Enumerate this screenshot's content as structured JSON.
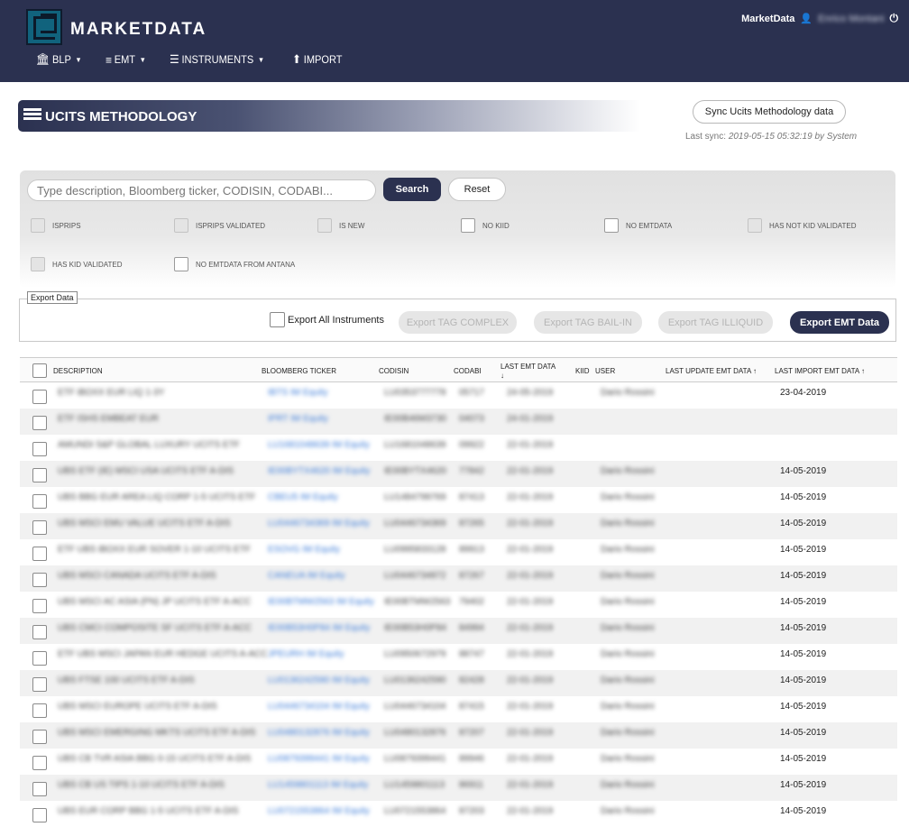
{
  "app": {
    "brand": "MARKETDATA",
    "user_app": "MarketData",
    "user_name": "Enrico Montani"
  },
  "nav": [
    {
      "label": "BLP",
      "icon": "bank-icon",
      "has_caret": true
    },
    {
      "label": "EMT",
      "icon": "database-icon",
      "has_caret": true
    },
    {
      "label": "INSTRUMENTS",
      "icon": "list-icon",
      "has_caret": true
    },
    {
      "label": "IMPORT",
      "icon": "upload-icon",
      "has_caret": false
    }
  ],
  "page": {
    "title": "UCITS METHODOLOGY",
    "sync_button": "Sync Ucits Methodology data",
    "last_sync_label": "Last sync: ",
    "last_sync_value": "2019-05-15 05:32:19 by System"
  },
  "search": {
    "placeholder": "Type description, Bloomberg ticker, CODISIN, CODABI...",
    "search_label": "Search",
    "reset_label": "Reset"
  },
  "filters": [
    {
      "label": "ISPRIPS",
      "style": "grey"
    },
    {
      "label": "ISPRIPS VALIDATED",
      "style": "grey"
    },
    {
      "label": "IS NEW",
      "style": "grey"
    },
    {
      "label": "NO KIID",
      "style": "white"
    },
    {
      "label": "NO EMTDATA",
      "style": "white"
    },
    {
      "label": "HAS NOT KID VALIDATED",
      "style": "grey"
    },
    {
      "label": "HAS KID VALIDATED",
      "style": "grey"
    },
    {
      "label": "NO EMTDATA FROM ANTANA",
      "style": "white"
    }
  ],
  "export": {
    "legend": "Export Data",
    "all_instruments": "Export All Instruments",
    "tag_complex": "Export TAG COMPLEX",
    "tag_bail_in": "Export TAG BAIL-IN",
    "tag_illiquid": "Export TAG ILLIQUID",
    "emt_data": "Export EMT Data"
  },
  "table": {
    "headers": {
      "description": "DESCRIPTION",
      "ticker": "BLOOMBERG TICKER",
      "codisin": "CODISIN",
      "codabi": "CODABI",
      "last_emt": "LAST EMT DATA",
      "last_emt_sort": "↓",
      "kiid": "KIID",
      "user": "USER",
      "last_update": "LAST UPDATE EMT DATA ↑",
      "last_import": "LAST IMPORT EMT DATA ↑"
    },
    "rows": [
      {
        "desc": "ETF iBOXX EUR LIQ 1-3Y",
        "ticker": "IBTS IM Equity",
        "isin": "LU0353777778",
        "abi": "05717",
        "emt": "24-05-2019",
        "user": "Dario Rossini",
        "import": "23-04-2019"
      },
      {
        "desc": "ETF ISHS EMBEAT EUR",
        "ticker": "IPRT IM Equity",
        "isin": "IE00B46M3730",
        "abi": "04073",
        "emt": "24-01-2019",
        "user": "",
        "import": ""
      },
      {
        "desc": "AMUNDI S&P GLOBAL LUXURY UCITS ETF",
        "ticker": "LU1681048639 IM Equity",
        "isin": "LU1681048639",
        "abi": "09922",
        "emt": "22-01-2019",
        "user": "",
        "import": ""
      },
      {
        "desc": "UBS ETF (IE) MSCI USA UCITS ETF A-DIS",
        "ticker": "IE00BYTX4620 IM Equity",
        "isin": "IE00BYTX4620",
        "abi": "77842",
        "emt": "22-01-2019",
        "user": "Dario Rossini",
        "import": "14-05-2019"
      },
      {
        "desc": "UBS BBG EUR AREA LIQ CORP 1-5 UCITS ETF",
        "ticker": "CBEU5 IM Equity",
        "isin": "LU1484799769",
        "abi": "87413",
        "emt": "22-01-2019",
        "user": "Dario Rossini",
        "import": "14-05-2019"
      },
      {
        "desc": "UBS MSCI EMU VALUE UCITS ETF A-DIS",
        "ticker": "LU0446734369 IM Equity",
        "isin": "LU0446734369",
        "abi": "87265",
        "emt": "22-01-2019",
        "user": "Dario Rossini",
        "import": "14-05-2019"
      },
      {
        "desc": "ETF UBS iBOXX EUR SOVER 1-10 UCITS ETF",
        "ticker": "ESOVG IM Equity",
        "isin": "LU0995833128",
        "abi": "89913",
        "emt": "22-01-2019",
        "user": "Dario Rossini",
        "import": "14-05-2019"
      },
      {
        "desc": "UBS MSCI CANADA UCITS ETF A-DIS",
        "ticker": "CANEUA IM Equity",
        "isin": "LU0446734872",
        "abi": "87267",
        "emt": "22-01-2019",
        "user": "Dario Rossini",
        "import": "14-05-2019"
      },
      {
        "desc": "UBS MSCI AC ASIA (PN) JP UCITS ETF A-ACC",
        "ticker": "IE00BTMW2563 IM Equity",
        "isin": "IE00BTMW2563",
        "abi": "79402",
        "emt": "22-01-2019",
        "user": "Dario Rossini",
        "import": "14-05-2019"
      },
      {
        "desc": "UBS CMCI COMPOSITE SF UCITS ETF A-ACC",
        "ticker": "IE00B53H0P84 IM Equity",
        "isin": "IE00B53H0P84",
        "abi": "84994",
        "emt": "22-01-2019",
        "user": "Dario Rossini",
        "import": "14-05-2019"
      },
      {
        "desc": "ETF UBS MSCI JAPAN EUR HEDGE UCITS A-ACC",
        "ticker": "JPEURH IM Equity",
        "isin": "LU0950672979",
        "abi": "88747",
        "emt": "22-01-2019",
        "user": "Dario Rossini",
        "import": "14-05-2019"
      },
      {
        "desc": "UBS FTSE 100 UCITS ETF A-DIS",
        "ticker": "LU0136242590 IM Equity",
        "isin": "LU0136242590",
        "abi": "82428",
        "emt": "22-01-2019",
        "user": "Dario Rossini",
        "import": "14-05-2019"
      },
      {
        "desc": "UBS MSCI EUROPE UCITS ETF A-DIS",
        "ticker": "LU0446734104 IM Equity",
        "isin": "LU0446734104",
        "abi": "87415",
        "emt": "22-01-2019",
        "user": "Dario Rossini",
        "import": "14-05-2019"
      },
      {
        "desc": "UBS MSCI EMERGING MKTS UCITS ETF A-DIS",
        "ticker": "LU0480132876 IM Equity",
        "isin": "LU0480132876",
        "abi": "87207",
        "emt": "22-01-2019",
        "user": "Dario Rossini",
        "import": "14-05-2019"
      },
      {
        "desc": "UBS CB TVR ASIA BBG 0-15 UCITS ETF A-DIS",
        "ticker": "LU0879399441 IM Equity",
        "isin": "LU0879399441",
        "abi": "89946",
        "emt": "22-01-2019",
        "user": "Dario Rossini",
        "import": "14-05-2019"
      },
      {
        "desc": "UBS CB US TIPS 1-10 UCITS ETF A-DIS",
        "ticker": "LU1459801113 IM Equity",
        "isin": "LU1459801113",
        "abi": "86911",
        "emt": "22-01-2019",
        "user": "Dario Rossini",
        "import": "14-05-2019"
      },
      {
        "desc": "UBS EUR CORP BBG 1-5 UCITS ETF A-DIS",
        "ticker": "LU0721553864 IM Equity",
        "isin": "LU0721553864",
        "abi": "87203",
        "emt": "22-01-2019",
        "user": "Dario Rossini",
        "import": "14-05-2019"
      }
    ]
  },
  "colors": {
    "navy": "#2b3150",
    "link": "#3b7bd8",
    "logo": "#11637d"
  }
}
